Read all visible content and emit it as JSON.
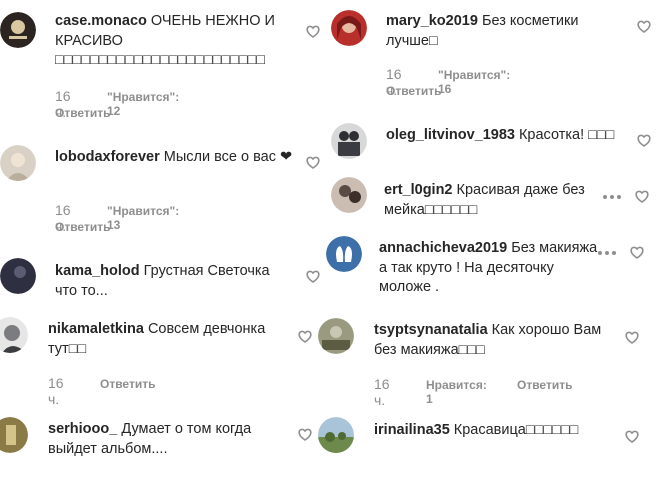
{
  "comments": [
    {
      "username": "case.monaco",
      "text": "ОЧЕНЬ НЕЖНО И КРАСИВО □□□□□□□□□□□□□□□□□□□□□□□□",
      "time": "16 ч.",
      "likes": "\"Нравится\": 12",
      "reply": "Ответить",
      "avatar_color": "#2b2420"
    },
    {
      "username": "lobodaxforever",
      "text": "Мысли все о вас ❤",
      "time": "16 ч.",
      "likes": "\"Нравится\": 13",
      "reply": "Ответить",
      "avatar_color": "#c9c0b3"
    },
    {
      "username": "kama_holod",
      "text": "Грустная Светочка что то...",
      "avatar_color": "#3e3f52"
    },
    {
      "username": "nikamaletkina",
      "text": "Совсем девчонка тут□□",
      "time": "16 ч.",
      "reply": "Ответить",
      "avatar_color": "#6e6f73"
    },
    {
      "username": "serhiooo_",
      "text": "Думает о том когда выйдет альбом....",
      "avatar_color": "#8a7a45"
    },
    {
      "username": "mary_ko2019",
      "text": "Без косметики лучше□",
      "time": "16 ч.",
      "likes": "\"Нравится\": 16",
      "reply": "Ответить",
      "avatar_color": "#b92f2b"
    },
    {
      "username": "oleg_litvinov_1983",
      "text": "Красотка! □□□",
      "avatar_color": "#4a4c52"
    },
    {
      "username": "ert_l0gin2",
      "text": "Красивая даже без мейка□□□□□□",
      "avatar_color": "#5c4a45"
    },
    {
      "username": "annachicheva2019",
      "text": "Без макияжа а так круто ! На десяточку моложе .",
      "avatar_color": "#3d6fa8"
    },
    {
      "username": "tsyptsynanatalia",
      "text": "Как хорошо Вам без макияжа□□□",
      "time": "16 ч.",
      "likes": "Нравится: 1",
      "reply": "Ответить",
      "avatar_color": "#7a7a5c"
    },
    {
      "username": "irinailina35",
      "text": "Красавица□□□□□□",
      "avatar_color": "#6d8a4c"
    }
  ],
  "icons": {
    "heart": "heart-icon",
    "more": "more-options-icon",
    "secondary_text_color": "#8e8e8e"
  }
}
